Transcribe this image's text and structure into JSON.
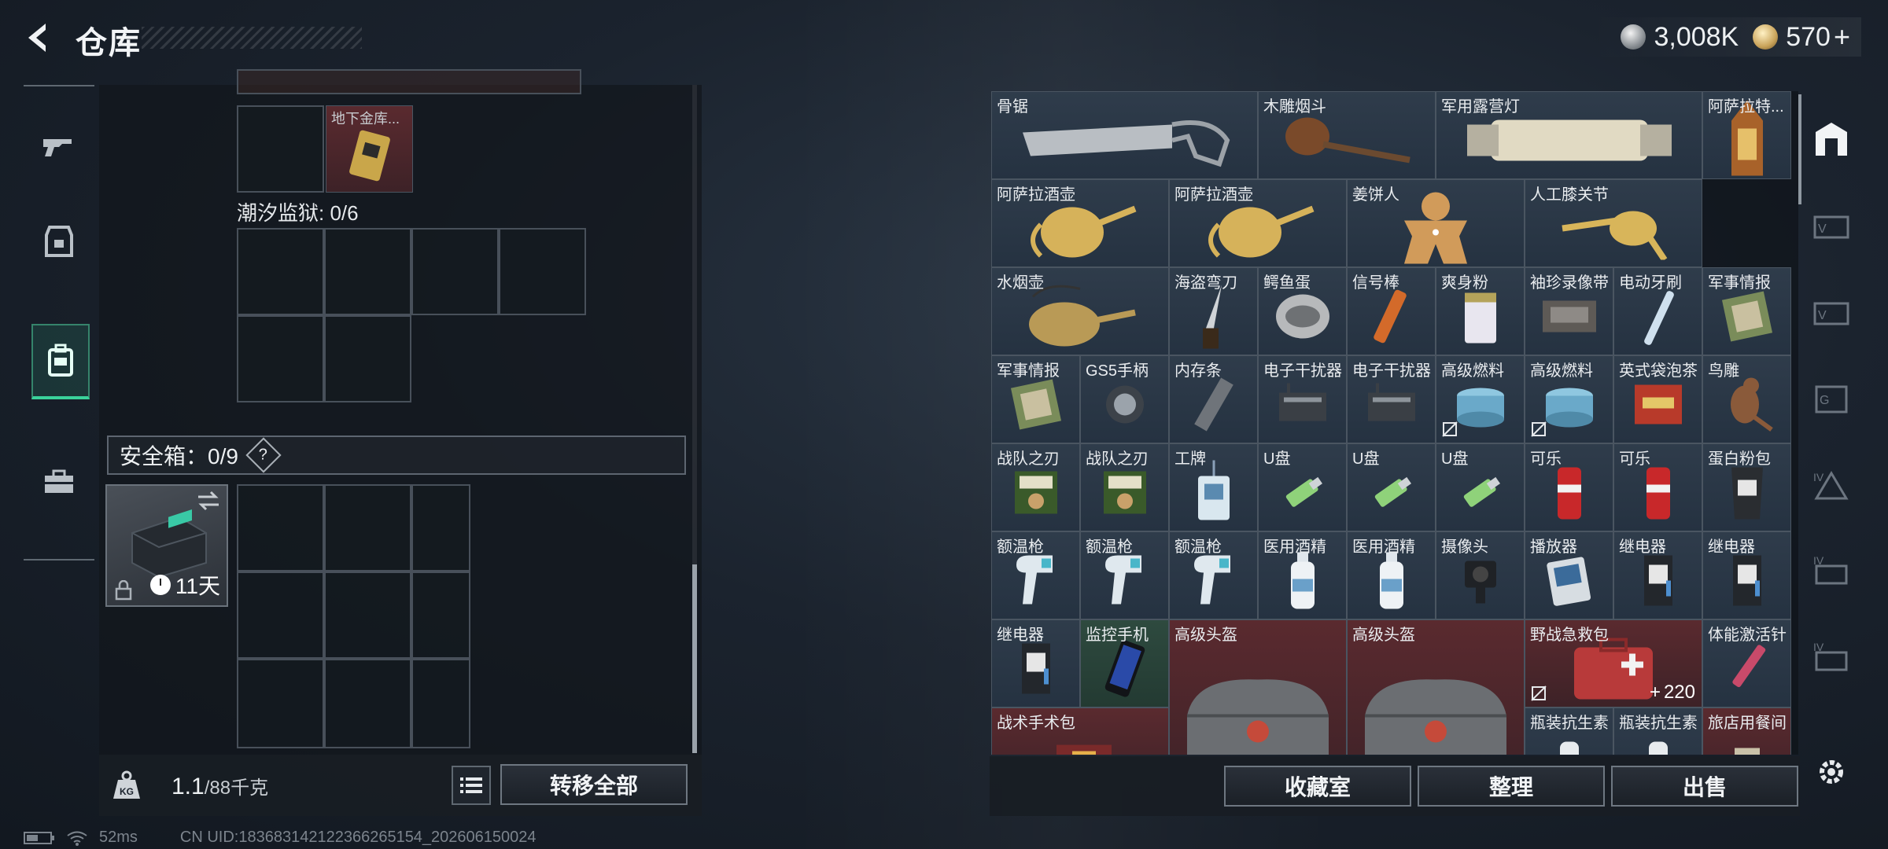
{
  "header": {
    "title": "仓库",
    "currency": [
      {
        "icon": "silver-coin-icon",
        "value": "3,008K"
      },
      {
        "icon": "gold-coin-icon",
        "value": "570"
      }
    ],
    "plus": "+"
  },
  "left_nav": {
    "items": [
      "weapon-icon",
      "armor-icon",
      "backpack-icon",
      "toolbox-icon"
    ],
    "active": 2
  },
  "stash": {
    "top_item_label": "地下金库...",
    "section_label": "潮汐监狱: 0/6",
    "safebox_label": "安全箱：0/9",
    "help": "?",
    "safebox_days": "11天",
    "weight_value": "1.1",
    "weight_unit": "/88千克",
    "transfer_all": "转移全部"
  },
  "inventory": {
    "items": [
      {
        "name": "骨锯"
      },
      {
        "name": "木雕烟斗"
      },
      {
        "name": "军用露营灯"
      },
      {
        "name": "阿萨拉特..."
      },
      {
        "name": "阿萨拉酒壶"
      },
      {
        "name": "阿萨拉酒壶"
      },
      {
        "name": "姜饼人"
      },
      {
        "name": "人工膝关节"
      },
      {
        "name": "水烟壶"
      },
      {
        "name": "海盗弯刀"
      },
      {
        "name": "鳄鱼蛋"
      },
      {
        "name": "信号棒"
      },
      {
        "name": "爽身粉"
      },
      {
        "name": "袖珍录像带"
      },
      {
        "name": "电动牙刷"
      },
      {
        "name": "军事情报"
      },
      {
        "name": "军事情报"
      },
      {
        "name": "GS5手柄"
      },
      {
        "name": "内存条"
      },
      {
        "name": "电子干扰器"
      },
      {
        "name": "电子干扰器"
      },
      {
        "name": "高级燃料"
      },
      {
        "name": "高级燃料"
      },
      {
        "name": "英式袋泡茶"
      },
      {
        "name": "鸟雕"
      },
      {
        "name": "战队之刃"
      },
      {
        "name": "战队之刃"
      },
      {
        "name": "工牌"
      },
      {
        "name": "U盘"
      },
      {
        "name": "U盘"
      },
      {
        "name": "U盘"
      },
      {
        "name": "可乐"
      },
      {
        "name": "可乐"
      },
      {
        "name": "蛋白粉包"
      },
      {
        "name": "额温枪"
      },
      {
        "name": "额温枪"
      },
      {
        "name": "额温枪"
      },
      {
        "name": "医用酒精"
      },
      {
        "name": "医用酒精"
      },
      {
        "name": "摄像头"
      },
      {
        "name": "播放器"
      },
      {
        "name": "继电器"
      },
      {
        "name": "继电器"
      },
      {
        "name": "继电器"
      },
      {
        "name": "监控手机"
      },
      {
        "name": "高级头盔"
      },
      {
        "name": "高级头盔"
      },
      {
        "name": "野战急救包",
        "count": "220"
      },
      {
        "name": "体能激活针"
      },
      {
        "name": "战术手术包"
      },
      {
        "name": "瓶装抗生素"
      },
      {
        "name": "瓶装抗生素"
      },
      {
        "name": "旅店用餐间"
      }
    ],
    "count_plus": "+"
  },
  "bottom": {
    "collection": "收藏室",
    "sort": "整理",
    "sell": "出售"
  },
  "status": {
    "latency": "52ms",
    "uid": "CN UID:18368314212236626515​4_202606150024"
  },
  "colors": {
    "accent": "#3ad29b",
    "rare": "#5a2a2f"
  }
}
